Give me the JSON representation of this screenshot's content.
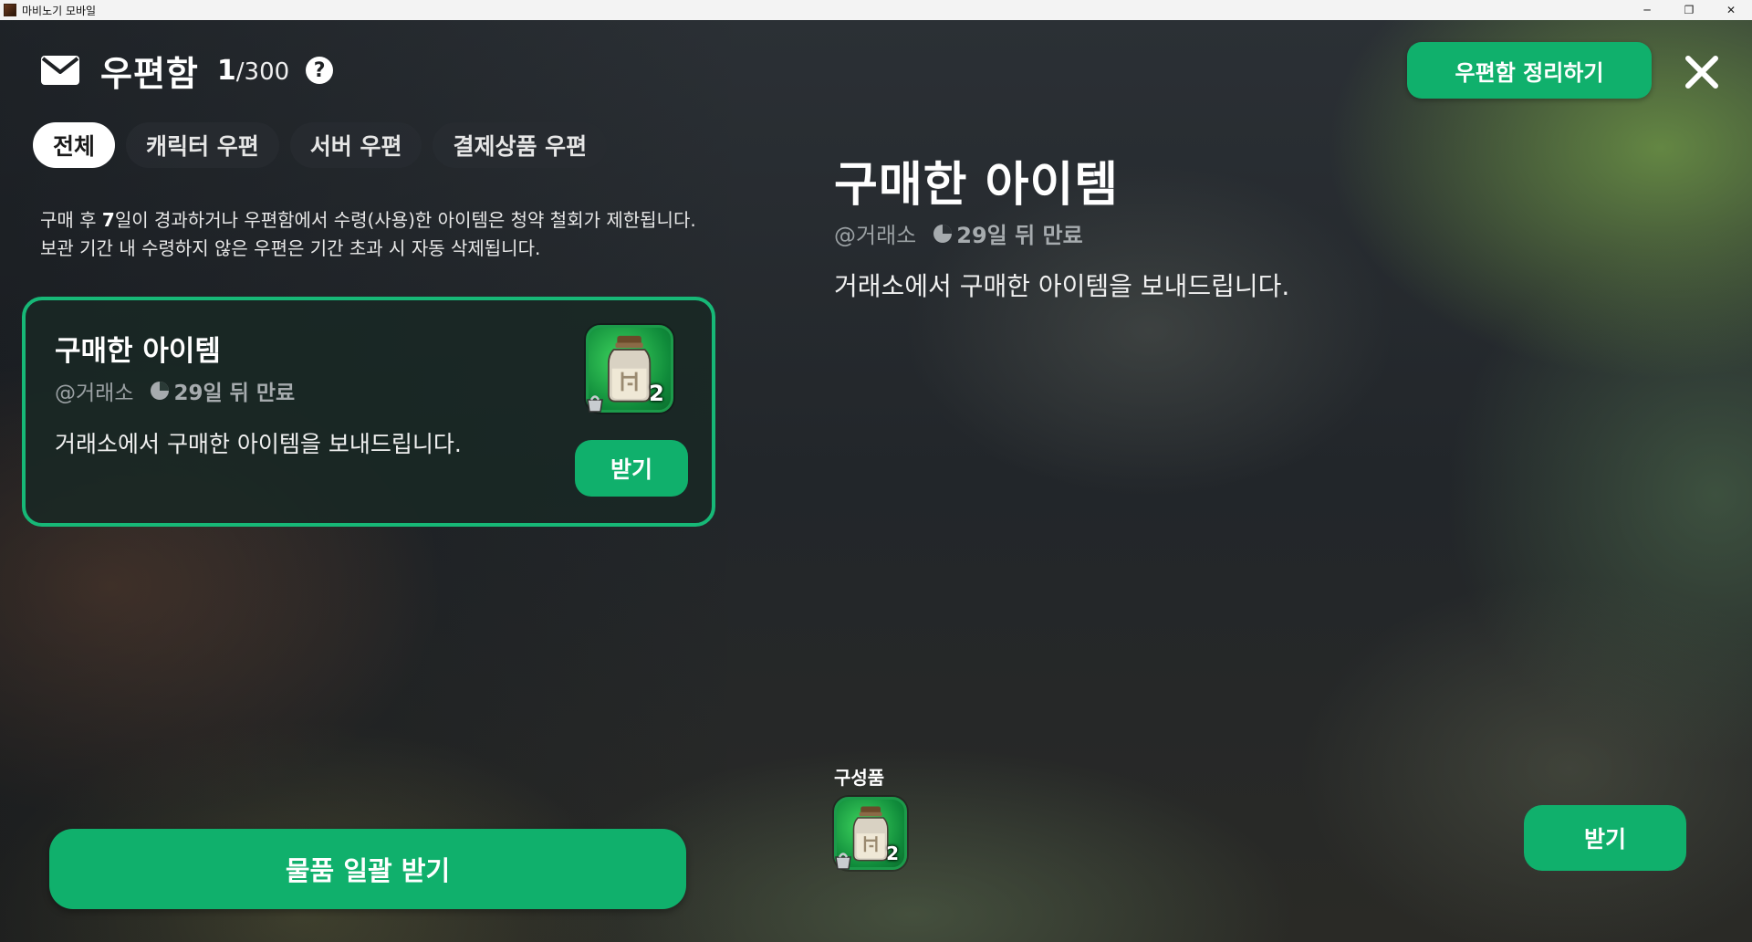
{
  "window": {
    "title": "마비노기 모바일",
    "controls": {
      "minimize": "─",
      "restore": "❐",
      "close": "✕"
    }
  },
  "header": {
    "title": "우편함",
    "count_current": "1",
    "count_separator": "/",
    "count_max": "300",
    "help_symbol": "?",
    "tidy_button": "우편함 정리하기",
    "icons": [
      "mail-icon",
      "help-icon",
      "close-icon"
    ]
  },
  "tabs": [
    {
      "label": "전체",
      "active": true
    },
    {
      "label": "캐릭터 우편",
      "active": false
    },
    {
      "label": "서버 우편",
      "active": false
    },
    {
      "label": "결제상품 우편",
      "active": false
    }
  ],
  "notice": {
    "line1_a": "구매 후 ",
    "line1_b": "7",
    "line1_c": "일이 경과하거나 우편함에서 수령(사용)한 아이템은 청약 철회가 제한됩니다.",
    "line2": "보관 기간 내 수령하지 않은 우편은 기간 초과 시 자동 삭제됩니다."
  },
  "mail_list": [
    {
      "title": "구매한 아이템",
      "sender": "@거래소",
      "expiry": "29일 뒤 만료",
      "description": "거래소에서 구매한 아이템을 보내드립니다.",
      "item_quantity": "2",
      "receive_label": "받기",
      "selected": true
    }
  ],
  "bulk_receive": "물품 일괄 받기",
  "detail": {
    "title": "구매한 아이템",
    "sender": "@거래소",
    "expiry": "29일 뒤 만료",
    "description": "거래소에서 구매한 아이템을 보내드립니다.",
    "components_label": "구성품",
    "component_quantity": "2",
    "receive_label": "받기"
  },
  "colors": {
    "accent_green": "#10b06c",
    "card_border": "#17b877",
    "muted_text": "#9aa0a3"
  }
}
